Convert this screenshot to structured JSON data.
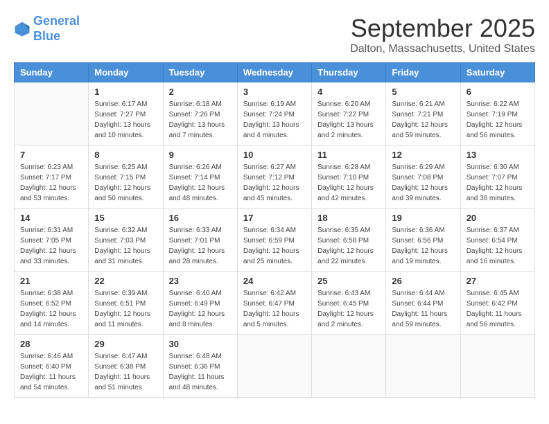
{
  "header": {
    "logo_line1": "General",
    "logo_line2": "Blue",
    "month": "September 2025",
    "location": "Dalton, Massachusetts, United States"
  },
  "weekdays": [
    "Sunday",
    "Monday",
    "Tuesday",
    "Wednesday",
    "Thursday",
    "Friday",
    "Saturday"
  ],
  "weeks": [
    [
      {
        "day": "",
        "info": ""
      },
      {
        "day": "1",
        "info": "Sunrise: 6:17 AM\nSunset: 7:27 PM\nDaylight: 13 hours\nand 10 minutes."
      },
      {
        "day": "2",
        "info": "Sunrise: 6:18 AM\nSunset: 7:26 PM\nDaylight: 13 hours\nand 7 minutes."
      },
      {
        "day": "3",
        "info": "Sunrise: 6:19 AM\nSunset: 7:24 PM\nDaylight: 13 hours\nand 4 minutes."
      },
      {
        "day": "4",
        "info": "Sunrise: 6:20 AM\nSunset: 7:22 PM\nDaylight: 13 hours\nand 2 minutes."
      },
      {
        "day": "5",
        "info": "Sunrise: 6:21 AM\nSunset: 7:21 PM\nDaylight: 12 hours\nand 59 minutes."
      },
      {
        "day": "6",
        "info": "Sunrise: 6:22 AM\nSunset: 7:19 PM\nDaylight: 12 hours\nand 56 minutes."
      }
    ],
    [
      {
        "day": "7",
        "info": "Sunrise: 6:23 AM\nSunset: 7:17 PM\nDaylight: 12 hours\nand 53 minutes."
      },
      {
        "day": "8",
        "info": "Sunrise: 6:25 AM\nSunset: 7:15 PM\nDaylight: 12 hours\nand 50 minutes."
      },
      {
        "day": "9",
        "info": "Sunrise: 6:26 AM\nSunset: 7:14 PM\nDaylight: 12 hours\nand 48 minutes."
      },
      {
        "day": "10",
        "info": "Sunrise: 6:27 AM\nSunset: 7:12 PM\nDaylight: 12 hours\nand 45 minutes."
      },
      {
        "day": "11",
        "info": "Sunrise: 6:28 AM\nSunset: 7:10 PM\nDaylight: 12 hours\nand 42 minutes."
      },
      {
        "day": "12",
        "info": "Sunrise: 6:29 AM\nSunset: 7:08 PM\nDaylight: 12 hours\nand 39 minutes."
      },
      {
        "day": "13",
        "info": "Sunrise: 6:30 AM\nSunset: 7:07 PM\nDaylight: 12 hours\nand 36 minutes."
      }
    ],
    [
      {
        "day": "14",
        "info": "Sunrise: 6:31 AM\nSunset: 7:05 PM\nDaylight: 12 hours\nand 33 minutes."
      },
      {
        "day": "15",
        "info": "Sunrise: 6:32 AM\nSunset: 7:03 PM\nDaylight: 12 hours\nand 31 minutes."
      },
      {
        "day": "16",
        "info": "Sunrise: 6:33 AM\nSunset: 7:01 PM\nDaylight: 12 hours\nand 28 minutes."
      },
      {
        "day": "17",
        "info": "Sunrise: 6:34 AM\nSunset: 6:59 PM\nDaylight: 12 hours\nand 25 minutes."
      },
      {
        "day": "18",
        "info": "Sunrise: 6:35 AM\nSunset: 6:58 PM\nDaylight: 12 hours\nand 22 minutes."
      },
      {
        "day": "19",
        "info": "Sunrise: 6:36 AM\nSunset: 6:56 PM\nDaylight: 12 hours\nand 19 minutes."
      },
      {
        "day": "20",
        "info": "Sunrise: 6:37 AM\nSunset: 6:54 PM\nDaylight: 12 hours\nand 16 minutes."
      }
    ],
    [
      {
        "day": "21",
        "info": "Sunrise: 6:38 AM\nSunset: 6:52 PM\nDaylight: 12 hours\nand 14 minutes."
      },
      {
        "day": "22",
        "info": "Sunrise: 6:39 AM\nSunset: 6:51 PM\nDaylight: 12 hours\nand 11 minutes."
      },
      {
        "day": "23",
        "info": "Sunrise: 6:40 AM\nSunset: 6:49 PM\nDaylight: 12 hours\nand 8 minutes."
      },
      {
        "day": "24",
        "info": "Sunrise: 6:42 AM\nSunset: 6:47 PM\nDaylight: 12 hours\nand 5 minutes."
      },
      {
        "day": "25",
        "info": "Sunrise: 6:43 AM\nSunset: 6:45 PM\nDaylight: 12 hours\nand 2 minutes."
      },
      {
        "day": "26",
        "info": "Sunrise: 6:44 AM\nSunset: 6:44 PM\nDaylight: 11 hours\nand 59 minutes."
      },
      {
        "day": "27",
        "info": "Sunrise: 6:45 AM\nSunset: 6:42 PM\nDaylight: 11 hours\nand 56 minutes."
      }
    ],
    [
      {
        "day": "28",
        "info": "Sunrise: 6:46 AM\nSunset: 6:40 PM\nDaylight: 11 hours\nand 54 minutes."
      },
      {
        "day": "29",
        "info": "Sunrise: 6:47 AM\nSunset: 6:38 PM\nDaylight: 11 hours\nand 51 minutes."
      },
      {
        "day": "30",
        "info": "Sunrise: 6:48 AM\nSunset: 6:36 PM\nDaylight: 11 hours\nand 48 minutes."
      },
      {
        "day": "",
        "info": ""
      },
      {
        "day": "",
        "info": ""
      },
      {
        "day": "",
        "info": ""
      },
      {
        "day": "",
        "info": ""
      }
    ]
  ]
}
